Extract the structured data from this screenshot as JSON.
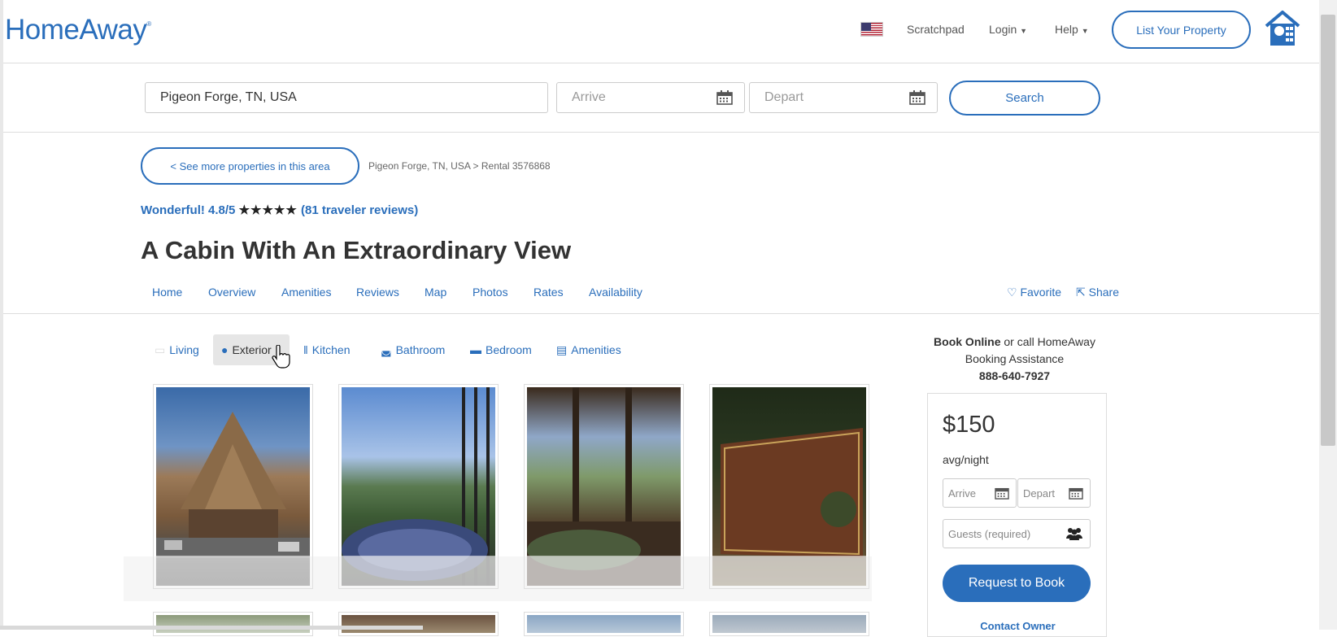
{
  "header": {
    "logo": "HomeAway",
    "logo_mark": "®",
    "nav": {
      "scratchpad": "Scratchpad",
      "login": "Login",
      "help": "Help"
    },
    "list_property": "List Your Property"
  },
  "search": {
    "location_value": "Pigeon Forge, TN, USA",
    "arrive_placeholder": "Arrive",
    "depart_placeholder": "Depart",
    "search_label": "Search"
  },
  "listing": {
    "back_label": "< See more properties in this area",
    "breadcrumb": "Pigeon Forge, TN, USA > Rental 3576868",
    "rating_text": "Wonderful! 4.8/5",
    "stars": "★★★★★",
    "rating_stars_value": 5,
    "reviews_link": "(81 traveler reviews)",
    "title": "A Cabin With An Extraordinary View"
  },
  "subnav": {
    "items": [
      "Home",
      "Overview",
      "Amenities",
      "Reviews",
      "Map",
      "Photos",
      "Rates",
      "Availability"
    ],
    "favorite": "Favorite",
    "share": "Share"
  },
  "photo_tabs": [
    {
      "label": "Living",
      "icon": "sofa-icon",
      "active": false
    },
    {
      "label": "Exterior",
      "icon": "tree-icon",
      "active": true
    },
    {
      "label": "Kitchen",
      "icon": "utensils-icon",
      "active": false
    },
    {
      "label": "Bathroom",
      "icon": "bathtub-icon",
      "active": false
    },
    {
      "label": "Bedroom",
      "icon": "bed-icon",
      "active": false
    },
    {
      "label": "Amenities",
      "icon": "amenities-icon",
      "active": false
    }
  ],
  "booking": {
    "book_online": "Book Online",
    "or_call": " or call HomeAway",
    "assist": "Booking Assistance",
    "phone": "888-640-7927",
    "price": "$150",
    "per_night": "avg/night",
    "arrive": "Arrive",
    "depart": "Depart",
    "guests": "Guests (required)",
    "request": "Request to Book",
    "contact": "Contact Owner"
  },
  "colors": {
    "brand": "#2a6ebb",
    "border": "#dddddd"
  }
}
